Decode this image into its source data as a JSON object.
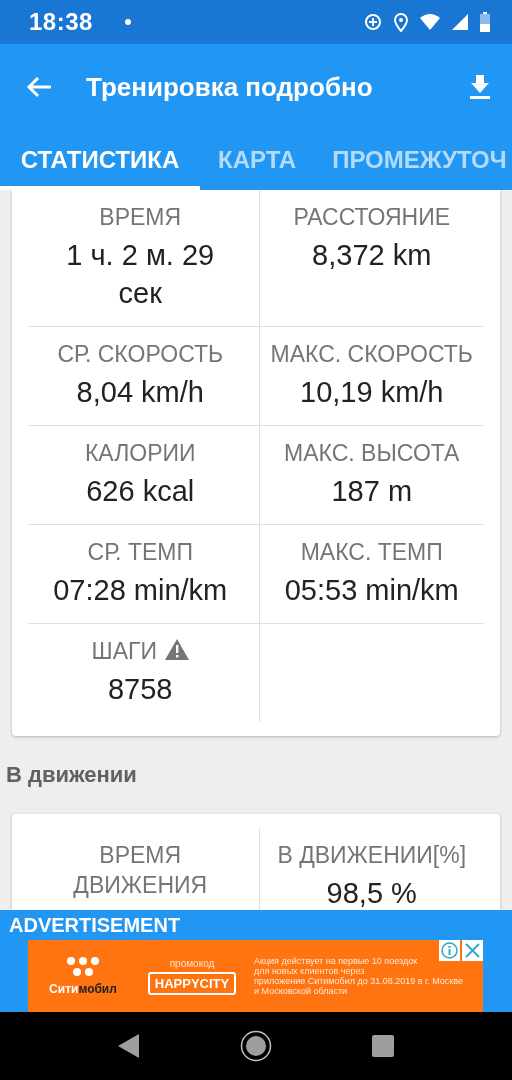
{
  "status_bar": {
    "time": "18:38"
  },
  "toolbar": {
    "title": "Тренировка подробно"
  },
  "tabs": [
    {
      "label": "СТАТИСТИКА",
      "selected": true
    },
    {
      "label": "КАРТА",
      "selected": false
    },
    {
      "label": "ПРОМЕЖУТОЧ",
      "selected": false
    }
  ],
  "summary_card": {
    "rows": [
      [
        {
          "label": "ВРЕМЯ",
          "value": "1 ч. 2 м. 29 сек",
          "warning": false
        },
        {
          "label": "РАССТОЯНИЕ",
          "value": "8,372 km",
          "warning": false
        }
      ],
      [
        {
          "label": "СР. СКОРОСТЬ",
          "value": "8,04 km/h",
          "warning": false
        },
        {
          "label": "МАКС. СКОРОСТЬ",
          "value": "10,19 km/h",
          "warning": false
        }
      ],
      [
        {
          "label": "КАЛОРИИ",
          "value": "626 kcal",
          "warning": false
        },
        {
          "label": "МАКС. ВЫСОТА",
          "value": "187 m",
          "warning": false
        }
      ],
      [
        {
          "label": "СР. ТЕМП",
          "value": "07:28 min/km",
          "warning": false
        },
        {
          "label": "МАКС. ТЕМП",
          "value": "05:53 min/km",
          "warning": false
        }
      ],
      [
        {
          "label": "ШАГИ",
          "value": "8758",
          "warning": true
        }
      ]
    ]
  },
  "moving_section": {
    "heading": "В движении",
    "rows": [
      [
        {
          "label": "ВРЕМЯ ДВИЖЕНИЯ",
          "warning": false
        },
        {
          "label": "В ДВИЖЕНИИ[%]",
          "value": "98,5 %",
          "warning": false
        }
      ]
    ]
  },
  "advertisement": {
    "label": "ADVERTISEMENT",
    "brand": "Сити**мобил**",
    "promo_label": "промокод",
    "promo_code": "HAPPYCITY",
    "text_lines": [
      "Акция действует на первые 10 поездок",
      "для новых клиентов через",
      "приложение Ситимобил до 31.08.2019 в г. Москве",
      "и Московской области"
    ]
  }
}
